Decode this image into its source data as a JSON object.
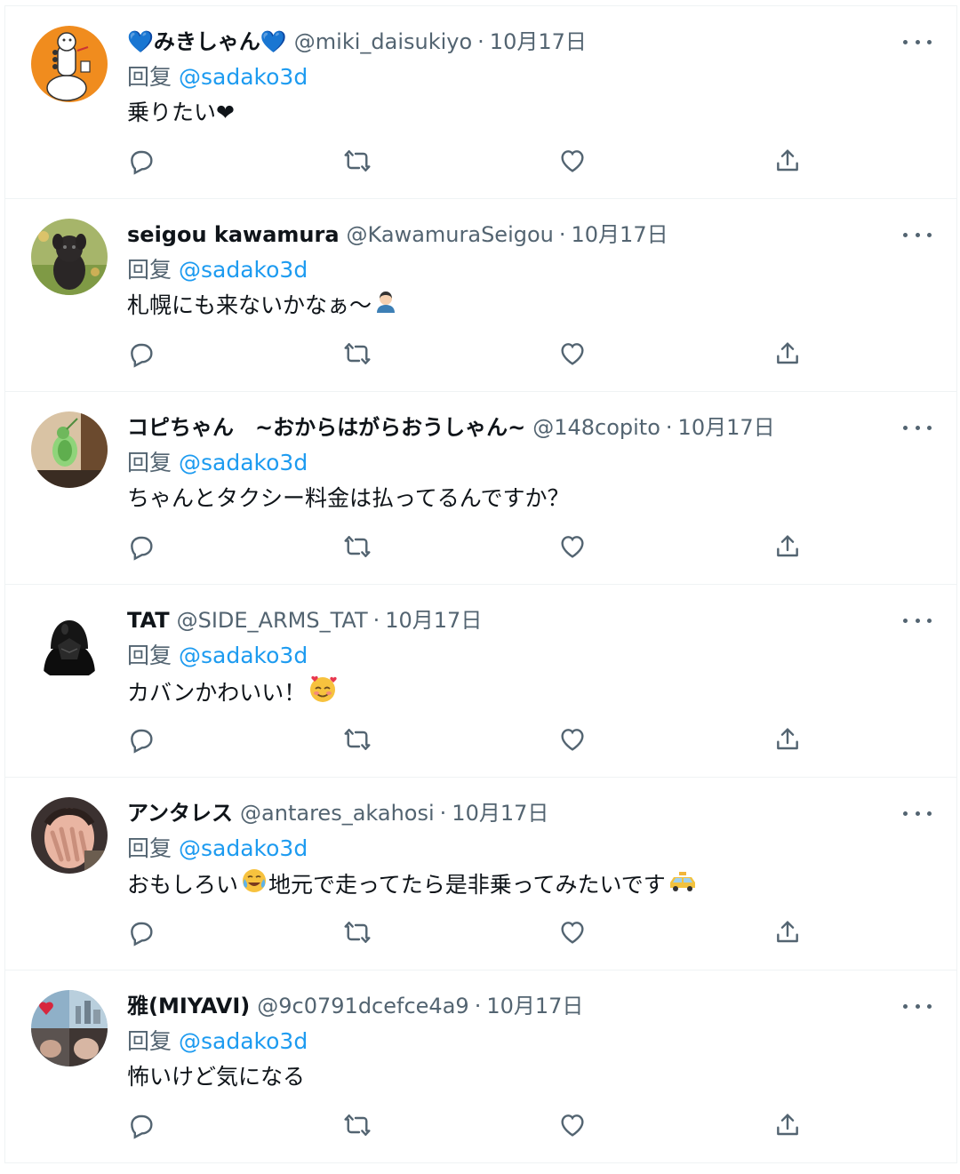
{
  "reply_prefix": "回复",
  "tweets": [
    {
      "name": "💙みきしゃん💙",
      "handle": "@miki_daisukiyo",
      "time": "10月17日",
      "mention": "@sadako3d",
      "text": "乗りたい❤",
      "avatar": "avatar-orange-illustration"
    },
    {
      "name": "seigou kawamura",
      "handle": "@KawamuraSeigou",
      "time": "10月17日",
      "mention": "@sadako3d",
      "text": "札幌にも来ないかなぁ〜",
      "avatar": "avatar-black-dog"
    },
    {
      "name": "コピちゃん　~おからはがらおうしゃん~",
      "handle": "@148copito",
      "time": "10月17日",
      "mention": "@sadako3d",
      "text": "ちゃんとタクシー料金は払ってるんですか？",
      "avatar": "avatar-green-bird"
    },
    {
      "name": "TAT",
      "handle": "@SIDE_ARMS_TAT",
      "time": "10月17日",
      "mention": "@sadako3d",
      "text": "カバンかわいい！",
      "avatar": "avatar-dark-helmet"
    },
    {
      "name": "アンタレス",
      "handle": "@antares_akahosi",
      "time": "10月17日",
      "mention": "@sadako3d",
      "text": "おもしろい",
      "text_after_emoji": "地元で走ってたら是非乗ってみたいです",
      "avatar": "avatar-face-hands"
    },
    {
      "name": "雅(MIYAVI)",
      "handle": "@9c0791dcefce4a9",
      "time": "10月17日",
      "mention": "@sadako3d",
      "text": "怖いけど気になる",
      "avatar": "avatar-collage"
    }
  ],
  "colors": {
    "accent": "#1d9bf0",
    "secondary_text": "#536471",
    "primary_text": "#0f1419",
    "divider": "#eff3f4"
  },
  "icons": [
    "reply-icon",
    "retweet-icon",
    "like-icon",
    "share-icon",
    "more-icon"
  ]
}
